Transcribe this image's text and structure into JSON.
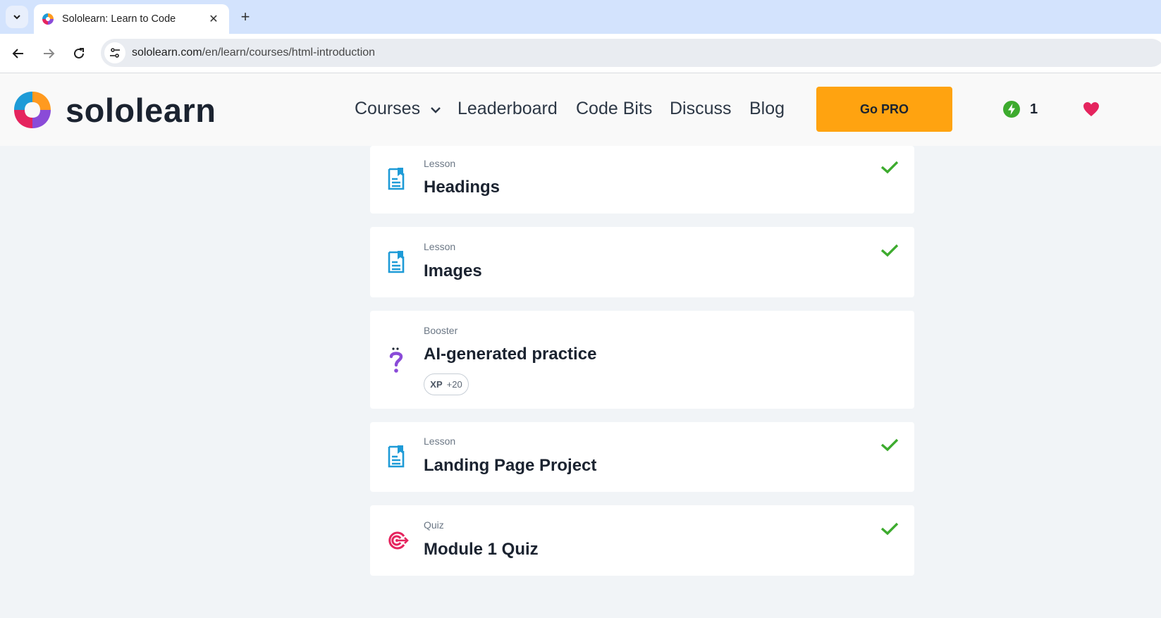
{
  "browser": {
    "tab_title": "Sololearn: Learn to Code",
    "url_domain": "sololearn.com",
    "url_path": "/en/learn/courses/html-introduction"
  },
  "header": {
    "logo_text": "sololearn",
    "nav": {
      "courses": "Courses",
      "leaderboard": "Leaderboard",
      "code_bits": "Code Bits",
      "discuss": "Discuss",
      "blog": "Blog"
    },
    "go_pro": "Go PRO",
    "streak_count": "1"
  },
  "lessons": [
    {
      "kind": "Lesson",
      "title": "Headings",
      "icon": "lesson-doc-icon",
      "completed": true
    },
    {
      "kind": "Lesson",
      "title": "Images",
      "icon": "lesson-doc-icon",
      "completed": true
    },
    {
      "kind": "Booster",
      "title": "AI-generated practice",
      "icon": "question-mark-icon",
      "completed": false,
      "xp_label": "XP",
      "xp_value": "+20"
    },
    {
      "kind": "Lesson",
      "title": "Landing Page Project",
      "icon": "lesson-doc-icon",
      "completed": true
    },
    {
      "kind": "Quiz",
      "title": "Module 1 Quiz",
      "icon": "target-icon",
      "completed": true
    }
  ],
  "colors": {
    "accent_orange": "#ffa310",
    "check_green": "#3dab2e",
    "lesson_blue": "#1e9bd7",
    "booster_purple": "#8a4bd8",
    "quiz_pink": "#e5245e"
  }
}
